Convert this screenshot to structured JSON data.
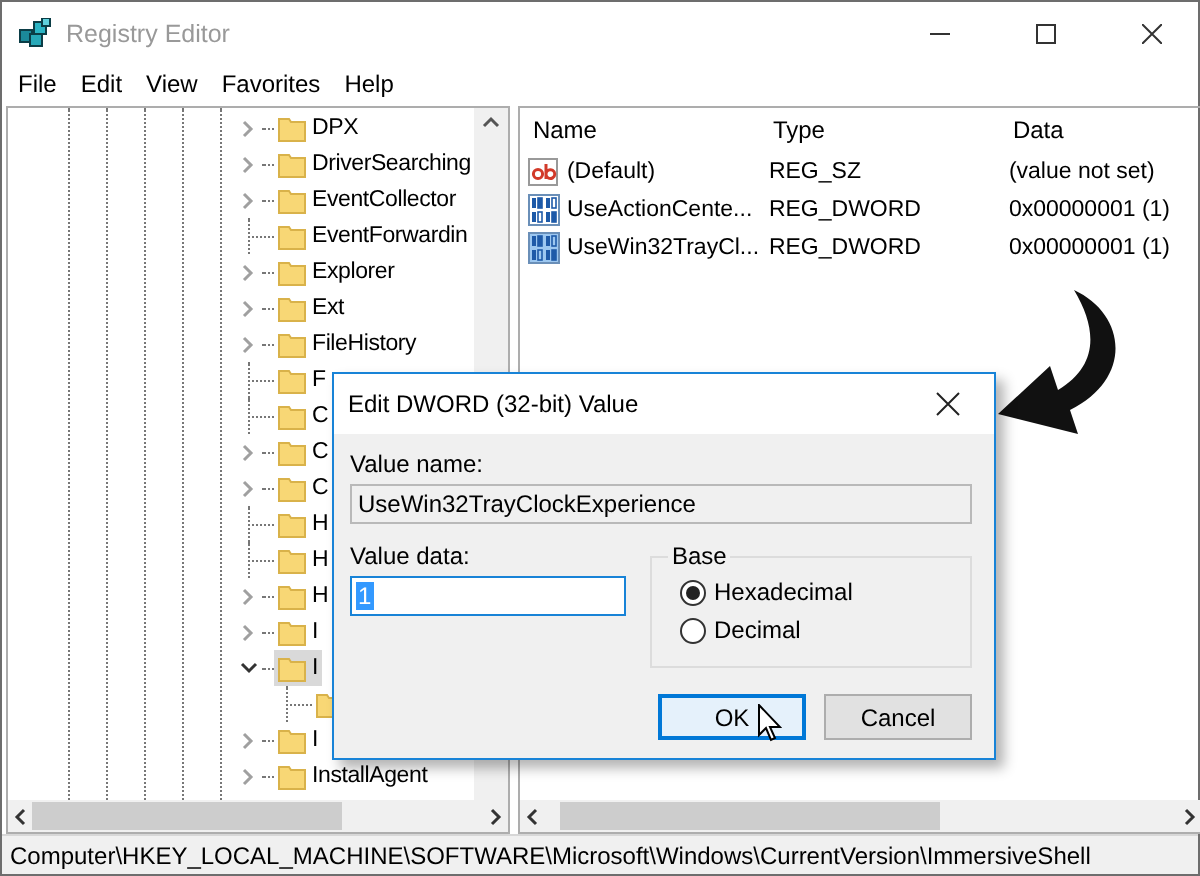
{
  "window": {
    "title": "Registry Editor"
  },
  "menu": [
    "File",
    "Edit",
    "View",
    "Favorites",
    "Help"
  ],
  "tree": [
    {
      "label": "DPX",
      "expandable": true,
      "expanded": false,
      "selected": false
    },
    {
      "label": "DriverSearching",
      "expandable": true,
      "expanded": false,
      "selected": false
    },
    {
      "label": "EventCollector",
      "expandable": true,
      "expanded": false,
      "selected": false
    },
    {
      "label": "EventForwardin",
      "expandable": false,
      "selected": false
    },
    {
      "label": "Explorer",
      "expandable": true,
      "expanded": false,
      "selected": false
    },
    {
      "label": "Ext",
      "expandable": true,
      "expanded": false,
      "selected": false
    },
    {
      "label": "FileHistory",
      "expandable": true,
      "expanded": false,
      "selected": false
    },
    {
      "label": "F",
      "expandable": false,
      "selected": false
    },
    {
      "label": "C",
      "expandable": false,
      "selected": false
    },
    {
      "label": "C",
      "expandable": true,
      "expanded": false,
      "selected": false
    },
    {
      "label": "C",
      "expandable": true,
      "expanded": false,
      "selected": false
    },
    {
      "label": "H",
      "expandable": false,
      "selected": false
    },
    {
      "label": "H",
      "expandable": false,
      "selected": false
    },
    {
      "label": "H",
      "expandable": true,
      "expanded": false,
      "selected": false
    },
    {
      "label": "I",
      "expandable": true,
      "expanded": false,
      "selected": false
    },
    {
      "label": "I",
      "expandable": true,
      "expanded": true,
      "selected": true,
      "children": [
        {
          "expandable": false,
          "selected": false
        }
      ]
    },
    {
      "label": "I",
      "expandable": true,
      "expanded": false,
      "selected": false
    },
    {
      "label": "InstallAgent",
      "expandable": true,
      "expanded": false,
      "selected": false
    }
  ],
  "table": {
    "columns": [
      "Name",
      "Type",
      "Data"
    ],
    "rows": [
      {
        "kind": "string",
        "name": "(Default)",
        "type": "REG_SZ",
        "data": "(value not set)",
        "selected": false
      },
      {
        "kind": "dword",
        "name": "UseActionCente...",
        "type": "REG_DWORD",
        "data": "0x00000001 (1)",
        "selected": false
      },
      {
        "kind": "dword",
        "name": "UseWin32TrayCl...",
        "type": "REG_DWORD",
        "data": "0x00000001 (1)",
        "selected": true
      }
    ]
  },
  "dialog": {
    "title": "Edit DWORD (32-bit) Value",
    "value_name_label": "Value name:",
    "value_name": "UseWin32TrayClockExperience",
    "value_data_label": "Value data:",
    "value_data": "1",
    "base": {
      "label": "Base",
      "options": [
        {
          "label": "Hexadecimal",
          "selected": true
        },
        {
          "label": "Decimal",
          "selected": false
        }
      ]
    },
    "buttons": [
      {
        "label": "OK",
        "default": true
      },
      {
        "label": "Cancel",
        "default": false
      }
    ]
  },
  "status_bar": "Computer\\HKEY_LOCAL_MACHINE\\SOFTWARE\\Microsoft\\Windows\\CurrentVersion\\ImmersiveShell"
}
